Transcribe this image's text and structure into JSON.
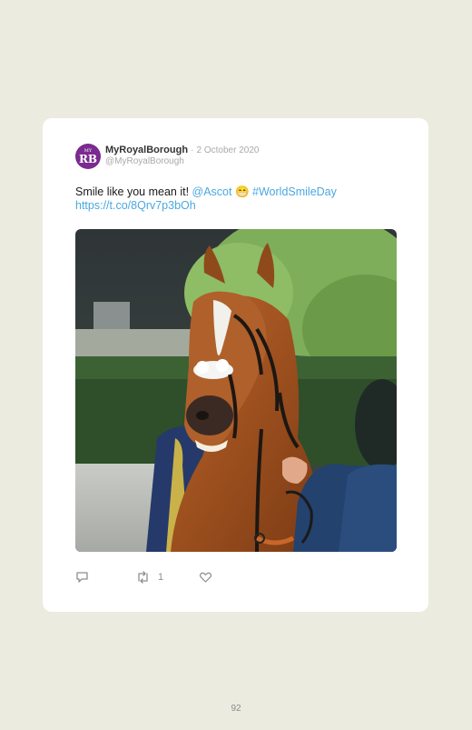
{
  "tweet": {
    "avatar_text_top": "MY",
    "avatar_text_main": "RB",
    "display_name": "MyRoyalBorough",
    "separator": "·",
    "date": "2 October 2020",
    "handle": "@MyRoyalBorough",
    "text_main": "Smile like you mean it! ",
    "mention": "@Ascot",
    "emoji": "😁",
    "hashtag": "#WorldSmileDay",
    "url": "https://t.co/8Qrv7p3bOh",
    "image_alt": "Chestnut racehorse with white blaze wearing a bridle, appearing to smile, led by a handler in a blue suit",
    "actions": {
      "reply_icon": "reply-icon",
      "retweet_icon": "retweet-icon",
      "retweet_count": "1",
      "like_icon": "heart-icon"
    }
  },
  "page": {
    "number": "92"
  },
  "colors": {
    "background": "#ecebdf",
    "card": "#ffffff",
    "link": "#4aa8e0",
    "avatar": "#7b2a8f"
  }
}
